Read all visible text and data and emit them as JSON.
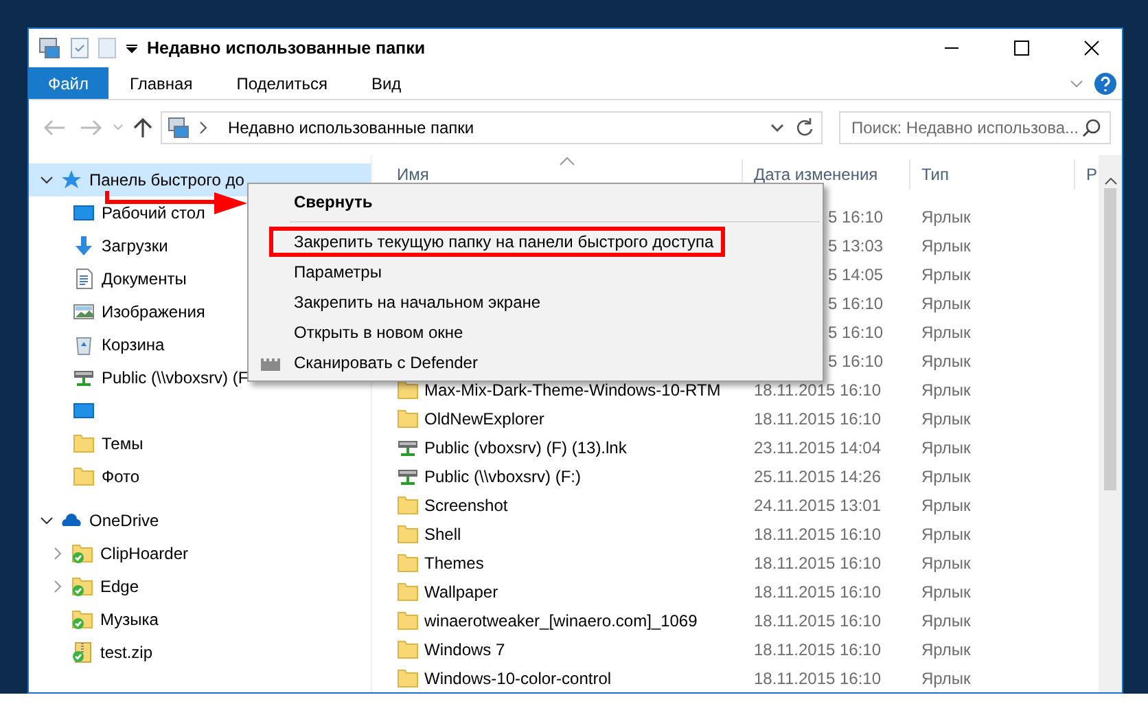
{
  "window": {
    "title": "Недавно использованные папки"
  },
  "ribbon_tabs": [
    {
      "label": "Файл",
      "selected": true
    },
    {
      "label": "Главная",
      "selected": false
    },
    {
      "label": "Поделиться",
      "selected": false
    },
    {
      "label": "Вид",
      "selected": false
    }
  ],
  "address_bar": {
    "path": "Недавно использованные папки"
  },
  "search": {
    "placeholder": "Поиск: Недавно использова..."
  },
  "navigation": [
    {
      "label": "Панель быстрого до",
      "kind": "star",
      "expanded": true,
      "selected": true,
      "children": [
        {
          "label": "Рабочий стол",
          "kind": "desktop"
        },
        {
          "label": "Загрузки",
          "kind": "download"
        },
        {
          "label": "Документы",
          "kind": "document"
        },
        {
          "label": "Изображения",
          "kind": "picture"
        },
        {
          "label": "Корзина",
          "kind": "bin"
        },
        {
          "label": "Public (\\\\vboxsrv) (F",
          "kind": "drive"
        },
        {
          "kind": "desktop"
        },
        {
          "label": "Темы",
          "kind": "folder"
        },
        {
          "label": "Фото",
          "kind": "folder"
        }
      ]
    },
    {
      "label": "OneDrive",
      "kind": "cloud",
      "expanded": true,
      "selected": false,
      "children": [
        {
          "label": "ClipHoarder",
          "kind": "syncfolder",
          "expandable": true
        },
        {
          "label": "Edge",
          "kind": "syncfolder",
          "expandable": true
        },
        {
          "label": "Музыка",
          "kind": "syncfolder",
          "expandable": false
        },
        {
          "label": "test.zip",
          "kind": "synczip",
          "expandable": false
        }
      ]
    }
  ],
  "columns": [
    "Имя",
    "Дата изменения",
    "Тип",
    "Р"
  ],
  "rows": [
    {
      "date": "5 16:10",
      "type": "Ярлык"
    },
    {
      "date": "5 13:03",
      "type": "Ярлык"
    },
    {
      "date": "5 14:05",
      "type": "Ярлык"
    },
    {
      "date": "5 16:10",
      "type": "Ярлык"
    },
    {
      "date": "5 16:10",
      "type": "Ярлык"
    },
    {
      "date": "5 16:10",
      "type": "Ярлык"
    },
    {
      "name": "Max-Mix-Dark-Theme-Windows-10-RTM",
      "kind": "folder",
      "date": "18.11.2015 16:10",
      "type": "Ярлык"
    },
    {
      "name": "OldNewExplorer",
      "kind": "folder",
      "date": "18.11.2015 16:10",
      "type": "Ярлык"
    },
    {
      "name": "Public (vboxsrv) (F) (13).lnk",
      "kind": "drive",
      "date": "23.11.2015 14:04",
      "type": "Ярлык"
    },
    {
      "name": "Public (\\\\vboxsrv) (F:)",
      "kind": "drive",
      "date": "25.11.2015 14:26",
      "type": "Ярлык"
    },
    {
      "name": "Screenshot",
      "kind": "folder",
      "date": "24.11.2015 13:01",
      "type": "Ярлык"
    },
    {
      "name": "Shell",
      "kind": "folder",
      "date": "18.11.2015 16:10",
      "type": "Ярлык"
    },
    {
      "name": "Themes",
      "kind": "folder",
      "date": "18.11.2015 16:10",
      "type": "Ярлык"
    },
    {
      "name": "Wallpaper",
      "kind": "folder",
      "date": "18.11.2015 16:10",
      "type": "Ярлык"
    },
    {
      "name": "winaerotweaker_[winaero.com]_1069",
      "kind": "folder",
      "date": "18.11.2015 16:10",
      "type": "Ярлык"
    },
    {
      "name": "Windows 7",
      "kind": "folder",
      "date": "18.11.2015 16:10",
      "type": "Ярлык"
    },
    {
      "name": "Windows-10-color-control",
      "kind": "folder",
      "date": "18.11.2015 16:10",
      "type": "Ярлык"
    }
  ],
  "context_menu": [
    {
      "label": "Свернуть",
      "default": true,
      "separator_after": true,
      "highlighted": false
    },
    {
      "label": "Закрепить текущую папку на панели быстрого доступа",
      "default": false,
      "separator_after": false,
      "highlighted": true
    },
    {
      "label": "Параметры",
      "default": false,
      "separator_after": false,
      "highlighted": false
    },
    {
      "label": "Закрепить на начальном экране",
      "default": false,
      "separator_after": false,
      "highlighted": false
    },
    {
      "label": "Открыть в новом окне",
      "default": false,
      "separator_after": false,
      "highlighted": false
    },
    {
      "label": "Сканировать с Defender",
      "default": false,
      "separator_after": false,
      "highlighted": false,
      "kind": "defender"
    }
  ]
}
